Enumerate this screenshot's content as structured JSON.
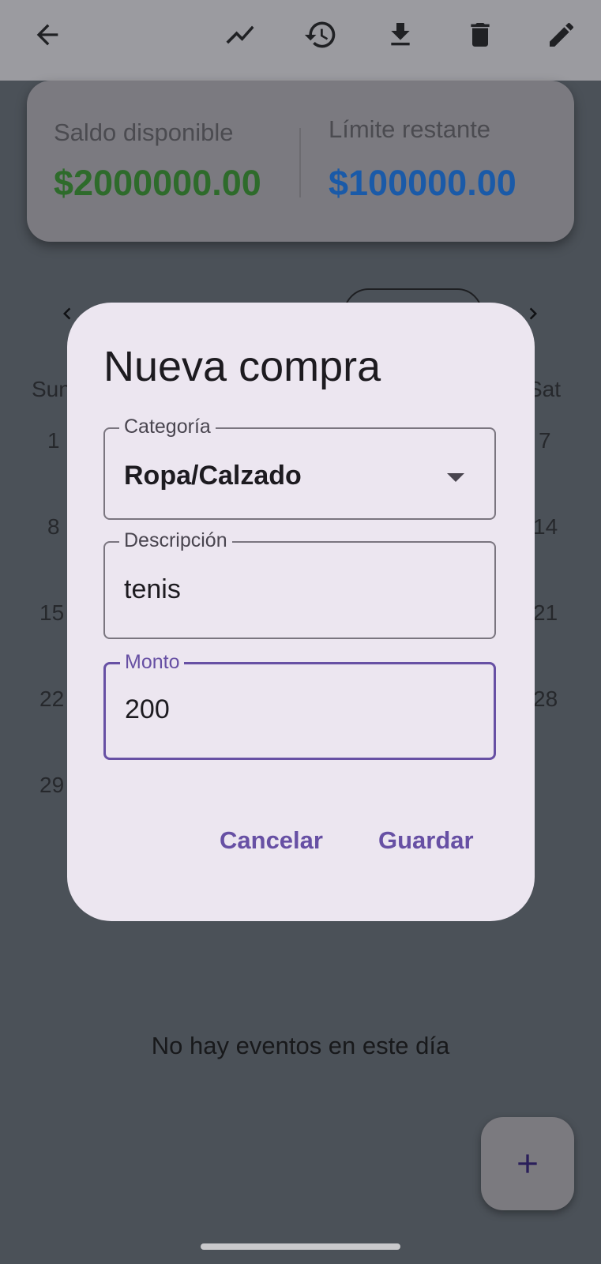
{
  "balance": {
    "available_label": "Saldo disponible",
    "available_value": "$2000000.00",
    "available_color": "#2e6b2b",
    "limit_label": "Límite restante",
    "limit_value": "$100000.00",
    "limit_color": "#1a5aa8"
  },
  "calendar": {
    "prev_icon": "chevron-left-icon",
    "next_icon": "chevron-right-icon",
    "weekday_first": "Sun",
    "weekday_last": "Sat",
    "left_column": [
      "1",
      "8",
      "15",
      "22",
      "29"
    ],
    "right_column": [
      "7",
      "14",
      "21",
      "28"
    ]
  },
  "events": {
    "empty_text": "No hay eventos en este día"
  },
  "dialog": {
    "title": "Nueva compra",
    "category_label": "Categoría",
    "category_value": "Ropa/Calzado",
    "description_label": "Descripción",
    "description_value": "tenis",
    "amount_label": "Monto",
    "amount_value": "200",
    "cancel_label": "Cancelar",
    "save_label": "Guardar",
    "accent_color": "#6750a4"
  },
  "toolbar": {
    "icons": [
      "back-arrow-icon",
      "trending-up-icon",
      "history-icon",
      "download-icon",
      "delete-icon",
      "edit-icon"
    ]
  }
}
